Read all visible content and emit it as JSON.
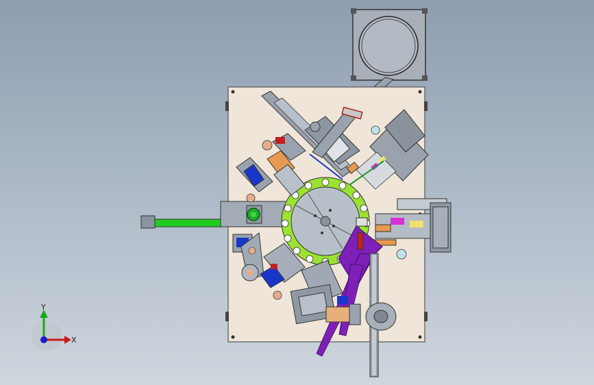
{
  "viewport": {
    "background_top": "#8e9db0",
    "background_bottom": "#cfd6de"
  },
  "colors": {
    "base_plate": "#efe5d8",
    "metal": "#8f9aa6",
    "metal_dark": "#5f6a76",
    "green": "#1fc81f",
    "lime": "#9ee832",
    "purple": "#7e1fb8",
    "orange": "#e79a4f",
    "blue": "#1a36c9",
    "red": "#d02020"
  },
  "triad": {
    "x_label": "X",
    "y_label": "Y",
    "x_color": "#d01818",
    "y_color": "#18a818",
    "z_color": "#1c1cc8"
  }
}
